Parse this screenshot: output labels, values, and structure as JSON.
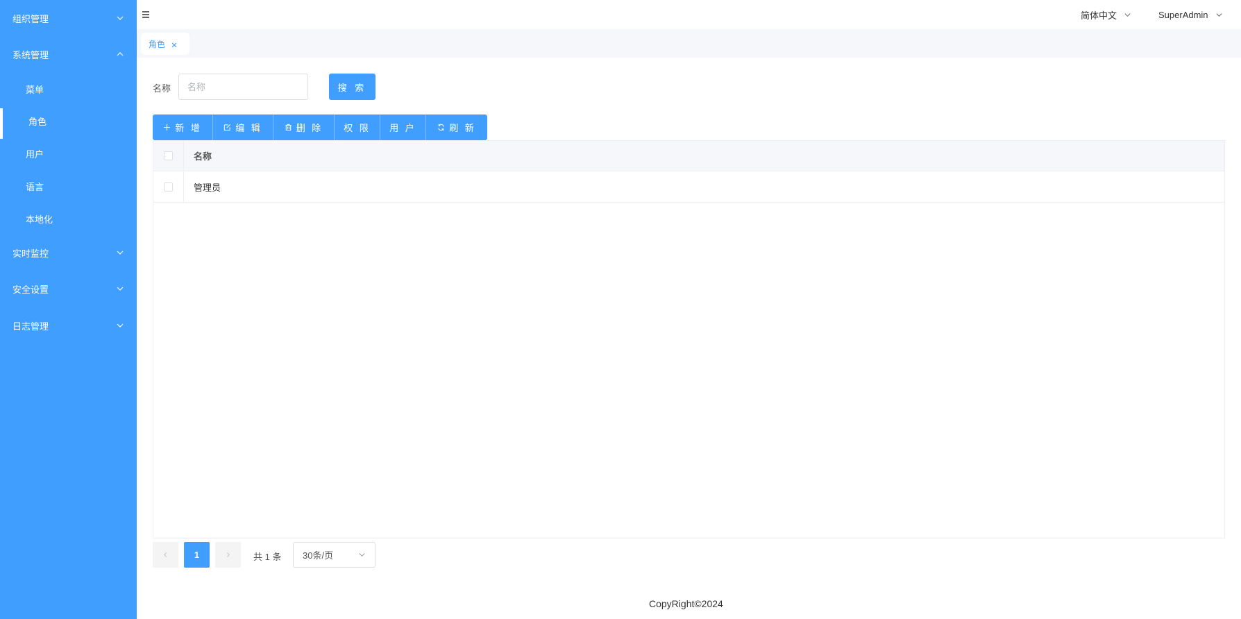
{
  "sidebar": {
    "groups": [
      {
        "label": "组织管理"
      },
      {
        "label": "系统管理"
      },
      {
        "label": "实时监控"
      },
      {
        "label": "安全设置"
      },
      {
        "label": "日志管理"
      }
    ],
    "system_items": [
      {
        "label": "菜单"
      },
      {
        "label": "角色"
      },
      {
        "label": "用户"
      },
      {
        "label": "语言"
      },
      {
        "label": "本地化"
      }
    ],
    "active_item": "角色"
  },
  "header": {
    "language": "简体中文",
    "user": "SuperAdmin"
  },
  "tabs": [
    {
      "label": "角色"
    }
  ],
  "search": {
    "label": "名称",
    "placeholder": "名称",
    "value": "",
    "button_label": "搜 索"
  },
  "toolbar": {
    "add": "新 增",
    "edit": "编 辑",
    "delete": "删 除",
    "permission": "权 限",
    "users": "用 户",
    "refresh": "刷 新"
  },
  "table": {
    "headers": [
      "名称"
    ],
    "rows": [
      {
        "name": "管理员"
      }
    ]
  },
  "pagination": {
    "current_page": "1",
    "total": "共 1 条",
    "page_size": "30条/页"
  },
  "footer": {
    "text": "CopyRight©2024"
  },
  "colors": {
    "primary": "#409eff",
    "sidebar_bg": "#409eff"
  }
}
